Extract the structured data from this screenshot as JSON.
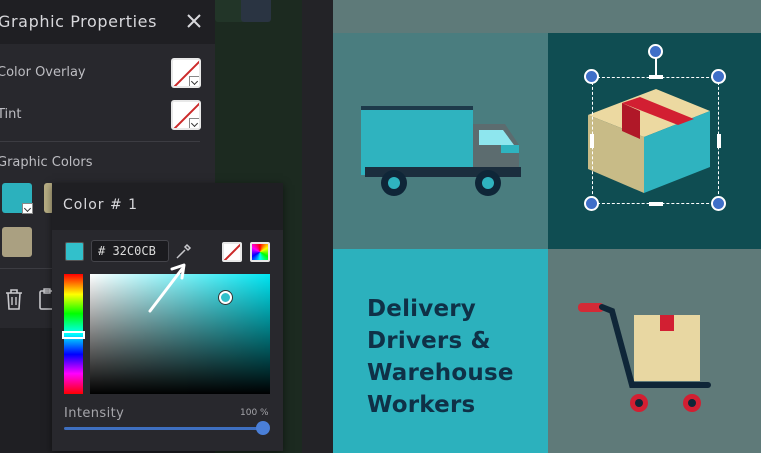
{
  "graphic_properties": {
    "title": "Graphic Properties",
    "color_overlay_label": "Color Overlay",
    "tint_label": "Tint",
    "graphic_colors_label": "Graphic Colors",
    "swatches": [
      "#2cb1bd",
      "#b8ae84",
      "#aaa081"
    ]
  },
  "color_picker": {
    "title": "Color # 1",
    "hex_value": "# 32C0CB",
    "current_color": "#32c0cb",
    "intensity_label": "Intensity",
    "intensity_value": "100 %",
    "intensity": 100
  },
  "canvas": {
    "headline_lines": [
      "Delivery",
      "Drivers &",
      "Warehouse",
      "Workers"
    ]
  }
}
